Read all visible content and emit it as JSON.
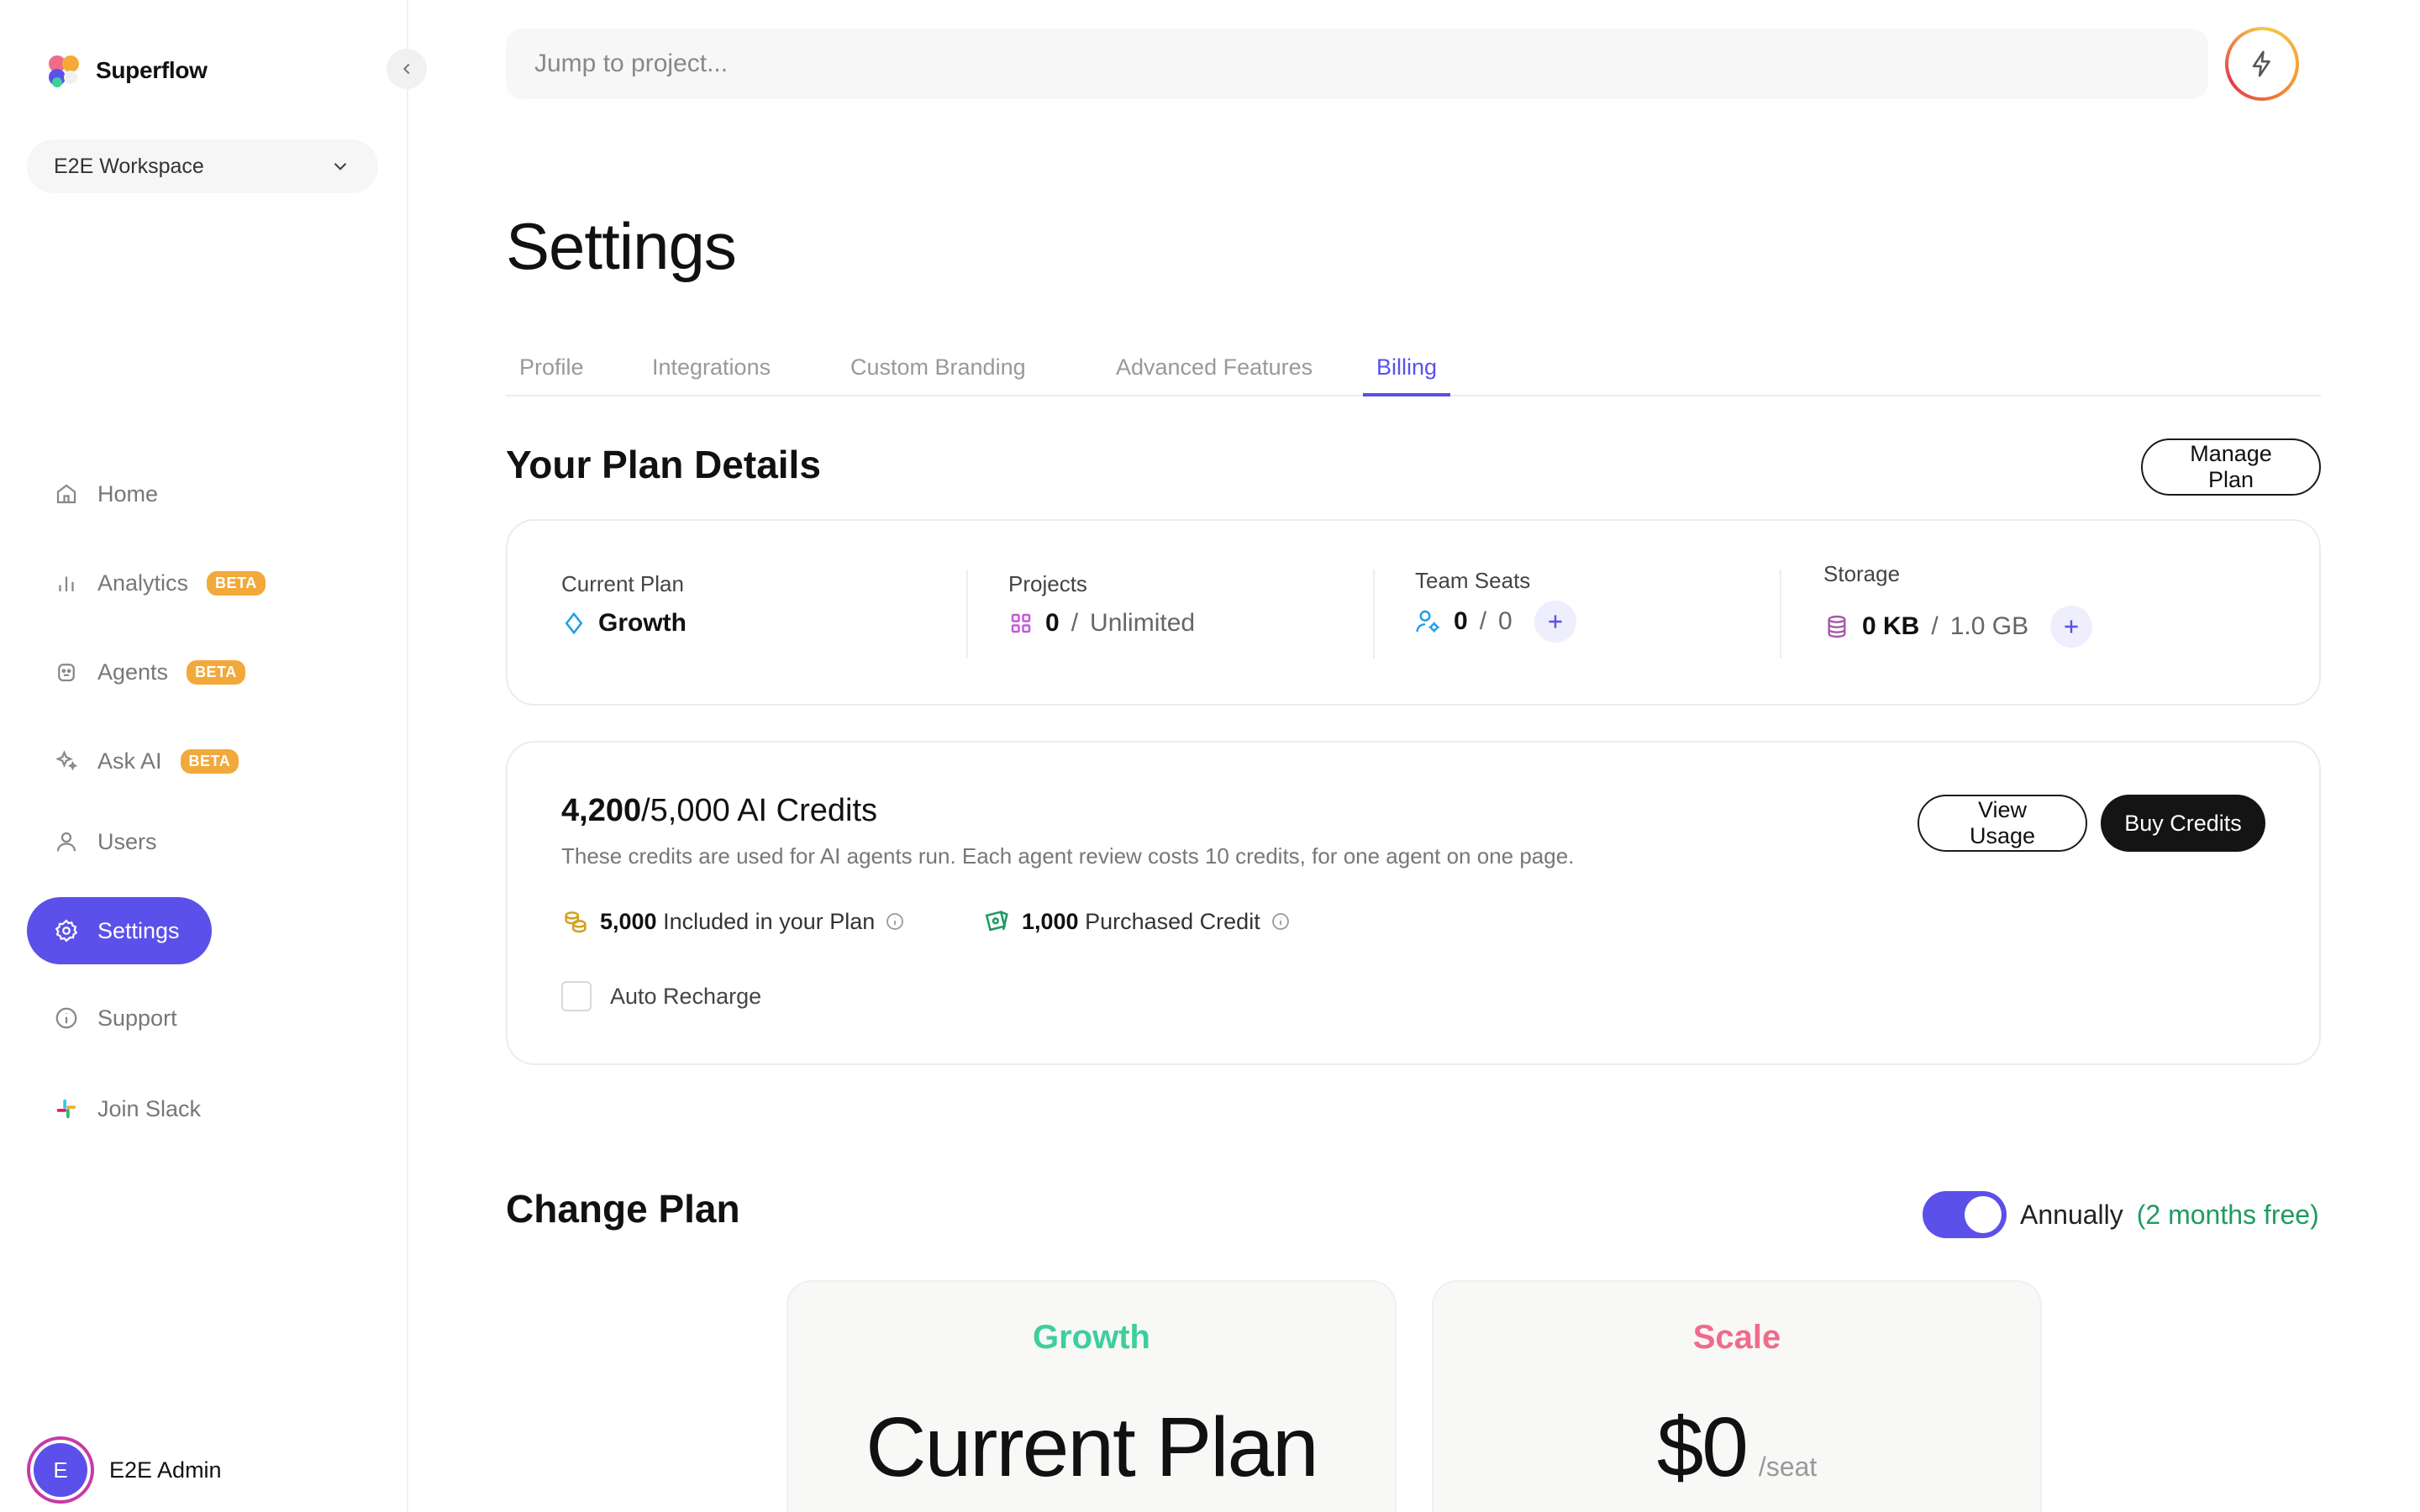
{
  "brand": {
    "name": "Superflow"
  },
  "workspace": {
    "name": "E2E Workspace"
  },
  "nav": {
    "home": "Home",
    "analytics": "Analytics",
    "agents": "Agents",
    "ask_ai": "Ask AI",
    "users": "Users",
    "settings": "Settings",
    "support": "Support",
    "join_slack": "Join Slack",
    "beta_badge": "BETA"
  },
  "user": {
    "initial": "E",
    "name": "E2E Admin"
  },
  "search": {
    "placeholder": "Jump to project..."
  },
  "page": {
    "title": "Settings"
  },
  "tabs": {
    "profile": "Profile",
    "integrations": "Integrations",
    "custom_branding": "Custom Branding",
    "advanced_features": "Advanced Features",
    "billing": "Billing",
    "active": "Billing"
  },
  "plan_details": {
    "title": "Your Plan Details",
    "manage_button": "Manage Plan",
    "current_plan": {
      "label": "Current Plan",
      "value": "Growth"
    },
    "projects": {
      "label": "Projects",
      "used": "0",
      "separator": "/",
      "limit": "Unlimited"
    },
    "team_seats": {
      "label": "Team Seats",
      "used": "0",
      "separator": "/",
      "limit": "0"
    },
    "storage": {
      "label": "Storage",
      "used": "0 KB",
      "separator": "/",
      "limit": "1.0 GB"
    }
  },
  "credits": {
    "used": "4,200",
    "total_text": "/5,000 AI Credits",
    "description": "These credits are used for AI agents run. Each agent review costs 10 credits, for one agent on one page.",
    "view_usage": "View Usage",
    "buy_credits": "Buy Credits",
    "included_amount": "5,000",
    "included_label": "Included in your Plan",
    "purchased_amount": "1,000",
    "purchased_label": "Purchased Credit",
    "auto_recharge": "Auto Recharge"
  },
  "change_plan": {
    "title": "Change Plan",
    "billing_label": "Annually",
    "billing_note": "(2 months free)",
    "annual_enabled": true,
    "plans": [
      {
        "name": "Growth",
        "headline": "Current Plan",
        "color": "#3ccf9c"
      },
      {
        "name": "Scale",
        "price": "$0",
        "unit": "/seat",
        "color": "#f06b8a"
      }
    ]
  },
  "colors": {
    "accent": "#5b50ea",
    "beta": "#f2a93b",
    "success": "#1f9a63"
  }
}
